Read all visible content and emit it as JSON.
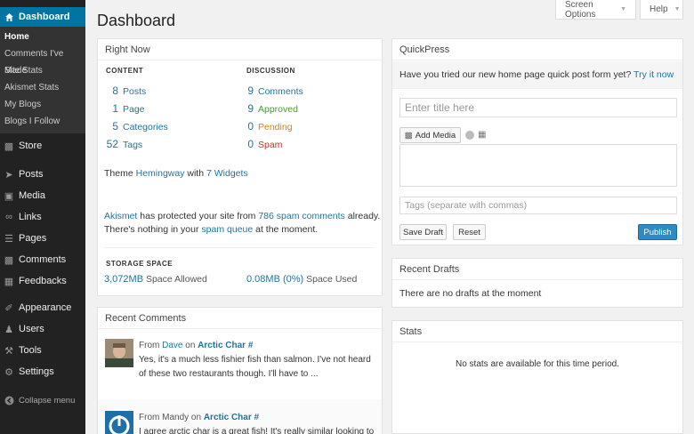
{
  "sidebar": {
    "current": {
      "label": "Dashboard",
      "icon": "home-icon"
    },
    "submenu": [
      "Home",
      "Comments I've Made",
      "Site Stats",
      "Akismet Stats",
      "My Blogs",
      "Blogs I Follow"
    ],
    "store": "Store",
    "items": [
      "Posts",
      "Media",
      "Links",
      "Pages",
      "Comments",
      "Feedbacks"
    ],
    "items2": [
      "Appearance",
      "Users",
      "Tools",
      "Settings"
    ],
    "collapse": "Collapse menu"
  },
  "header": {
    "title": "Dashboard",
    "screen_options": "Screen Options",
    "help": "Help"
  },
  "right_now": {
    "title": "Right Now",
    "content_head": "CONTENT",
    "discussion_head": "DISCUSSION",
    "content": [
      {
        "count": "8",
        "label": "Posts"
      },
      {
        "count": "1",
        "label": "Page"
      },
      {
        "count": "5",
        "label": "Categories"
      },
      {
        "count": "52",
        "label": "Tags"
      }
    ],
    "discussion": [
      {
        "count": "9",
        "label": "Comments"
      },
      {
        "count": "9",
        "label": "Approved"
      },
      {
        "count": "0",
        "label": "Pending"
      },
      {
        "count": "0",
        "label": "Spam"
      }
    ],
    "theme_prefix": "Theme",
    "theme_name": "Hemingway",
    "theme_with": "with",
    "widgets": "7 Widgets",
    "akismet": "Akismet",
    "akismet_mid": "has protected your site from",
    "spam_count": "786 spam comments",
    "akismet_end": "already.",
    "akismet_line2a": "There's nothing in your",
    "spam_queue": "spam queue",
    "akismet_line2b": "at the moment.",
    "storage_head": "STORAGE SPACE",
    "allowed_val": "3,072MB",
    "allowed_label": "Space Allowed",
    "used_val": "0.08MB (0%)",
    "used_label": "Space Used"
  },
  "recent_comments": {
    "title": "Recent Comments",
    "items": [
      {
        "from": "From",
        "author": "Dave",
        "on": "on",
        "post": "Arctic Char #",
        "line1": "Yes, it's a much less fishier fish than salmon. I've not heard",
        "line2": "of these two restaurants though. I'll have to ..."
      },
      {
        "from": "From",
        "author": "Mandy",
        "on": "on",
        "post": "Arctic Char #",
        "line1": "I agree arctic char is a great fish! It's really similar looking to"
      }
    ]
  },
  "quickpress": {
    "title": "QuickPress",
    "notice": "Have you tried our new home page quick post form yet?",
    "try_link": "Try it now →",
    "title_placeholder": "Enter title here",
    "add_media": "Add Media",
    "tags_placeholder": "Tags (separate with commas)",
    "save_draft": "Save Draft",
    "reset": "Reset",
    "publish": "Publish"
  },
  "recent_drafts": {
    "title": "Recent Drafts",
    "empty": "There are no drafts at the moment"
  },
  "stats": {
    "title": "Stats",
    "empty": "No stats are available for this time period."
  }
}
